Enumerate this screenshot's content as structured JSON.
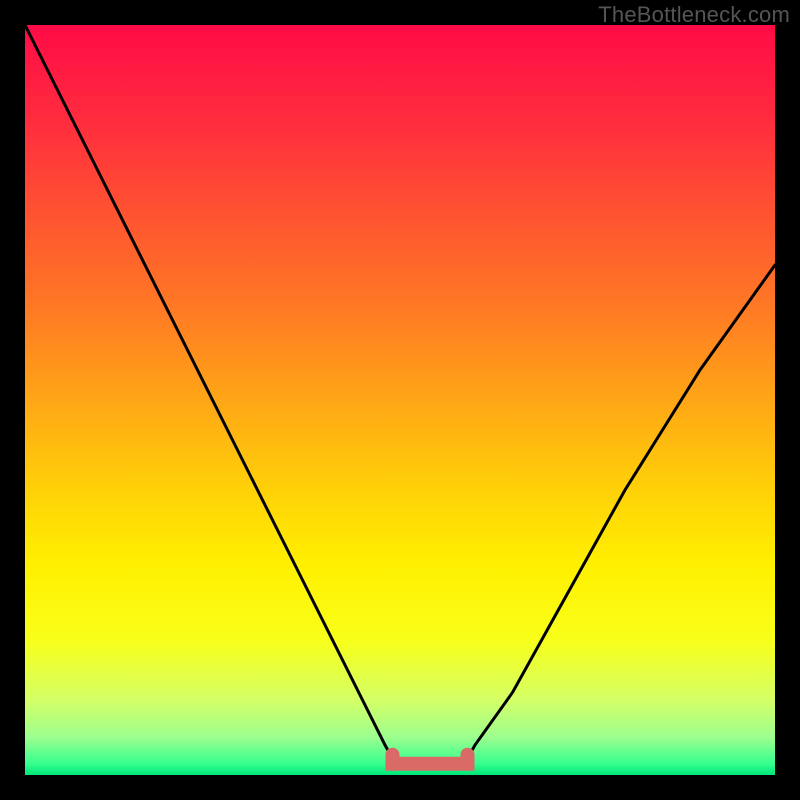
{
  "watermark": "TheBottleneck.com",
  "chart_data": {
    "type": "line",
    "title": "",
    "xlabel": "",
    "ylabel": "",
    "xlim": [
      0,
      100
    ],
    "ylim": [
      0,
      100
    ],
    "series": [
      {
        "name": "bottleneck-curve",
        "x": [
          0,
          5,
          10,
          15,
          20,
          25,
          30,
          35,
          40,
          45,
          48,
          49,
          50,
          55,
          58,
          59,
          60,
          65,
          70,
          75,
          80,
          85,
          90,
          95,
          100
        ],
        "y": [
          100,
          90,
          80,
          70,
          60,
          50,
          40,
          30,
          20,
          10,
          4,
          2.2,
          1.5,
          1.5,
          1.5,
          2.2,
          4,
          11,
          20,
          29,
          38,
          46,
          54,
          61,
          68
        ]
      }
    ],
    "highlight_segment": {
      "name": "optimal-range",
      "x_start": 49,
      "x_end": 59,
      "y": 1.5
    },
    "gradient_stops": [
      {
        "offset": 0.0,
        "color": "#ff0b46"
      },
      {
        "offset": 0.12,
        "color": "#ff2a3f"
      },
      {
        "offset": 0.25,
        "color": "#ff5231"
      },
      {
        "offset": 0.38,
        "color": "#ff7a24"
      },
      {
        "offset": 0.5,
        "color": "#ffa616"
      },
      {
        "offset": 0.62,
        "color": "#ffd108"
      },
      {
        "offset": 0.72,
        "color": "#fff000"
      },
      {
        "offset": 0.82,
        "color": "#f8ff1a"
      },
      {
        "offset": 0.9,
        "color": "#d4ff66"
      },
      {
        "offset": 0.95,
        "color": "#9cff8f"
      },
      {
        "offset": 0.985,
        "color": "#35ff8e"
      },
      {
        "offset": 1.0,
        "color": "#00e57a"
      }
    ]
  }
}
